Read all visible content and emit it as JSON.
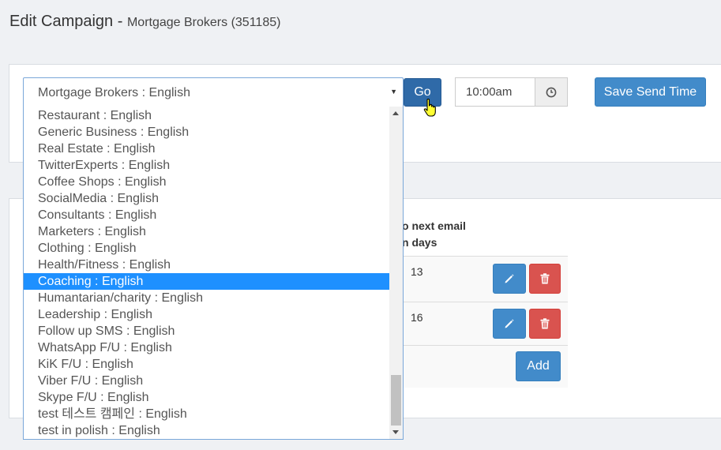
{
  "header": {
    "title": "Edit Campaign",
    "separator": " - ",
    "subtitle": "Mortgage Brokers (351185)"
  },
  "campaign_select": {
    "value": "Mortgage Brokers : English",
    "options": [
      "Restaurant : English",
      "Generic Business : English",
      "Real Estate : English",
      "TwitterExperts : English",
      "Coffee Shops : English",
      "SocialMedia : English",
      "Consultants : English",
      "Marketers : English",
      "Clothing : English",
      "Health/Fitness : English",
      "Coaching : English",
      "Humantarian/charity : English",
      "Leadership : English",
      "Follow up SMS : English",
      "WhatsApp F/U : English",
      "KiK F/U : English",
      "Viber F/U : English",
      "Skype F/U : English",
      "test 테스트 캠페인 : English",
      "test in polish : English"
    ],
    "highlighted": "Coaching : English"
  },
  "toolbar": {
    "go_label": "Go",
    "time_value": "10:00am",
    "save_label": "Save Send Time"
  },
  "table": {
    "header_line1": "o next email",
    "header_line2": "n days",
    "rows": [
      {
        "days": "13"
      },
      {
        "days": "16"
      }
    ],
    "add_label": "Add"
  },
  "icons": {
    "time_addon": "clock-icon",
    "edit": "pencil-icon",
    "delete": "trash-icon",
    "cursor": "hand-pointer-icon"
  },
  "colors": {
    "primary": "#428bca",
    "go_active": "#2f6aa8",
    "danger": "#d9534f",
    "highlight": "#1e90ff"
  }
}
